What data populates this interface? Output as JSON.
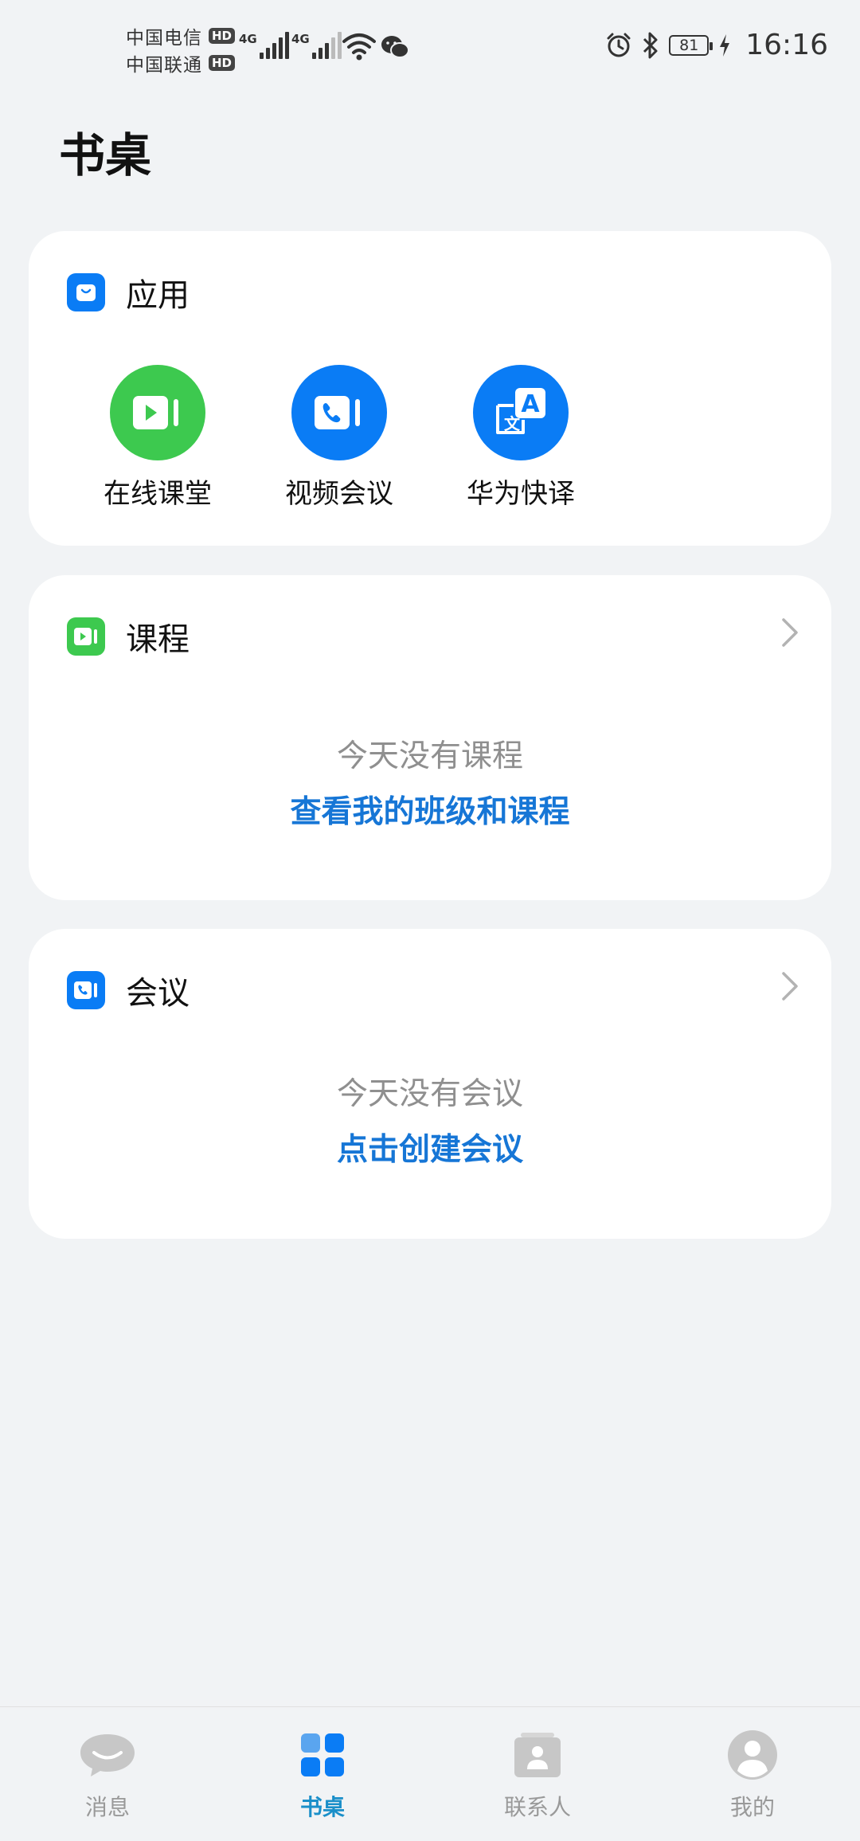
{
  "status_bar": {
    "carriers": [
      {
        "name": "中国电信",
        "badge": "HD"
      },
      {
        "name": "中国联通",
        "badge": "HD"
      }
    ],
    "network_tags": [
      "4G",
      "4G"
    ],
    "battery": "81",
    "time": "16:16"
  },
  "page_title": "书桌",
  "apps_card": {
    "title": "应用",
    "items": [
      {
        "label": "在线课堂",
        "icon": "online-class-icon",
        "color": "#3dc94f"
      },
      {
        "label": "视频会议",
        "icon": "video-call-icon",
        "color": "#0a7cf5"
      },
      {
        "label": "华为快译",
        "icon": "translate-icon",
        "color": "#0a7cf5"
      }
    ]
  },
  "courses_card": {
    "title": "课程",
    "empty_text": "今天没有课程",
    "link_text": "查看我的班级和课程"
  },
  "meetings_card": {
    "title": "会议",
    "empty_text": "今天没有会议",
    "link_text": "点击创建会议"
  },
  "bottom_nav": {
    "items": [
      {
        "label": "消息",
        "icon": "chat-bubble-icon",
        "active": false
      },
      {
        "label": "书桌",
        "icon": "desk-grid-icon",
        "active": true
      },
      {
        "label": "联系人",
        "icon": "contacts-icon",
        "active": false
      },
      {
        "label": "我的",
        "icon": "profile-icon",
        "active": false
      }
    ]
  },
  "colors": {
    "background": "#f1f3f5",
    "card": "#ffffff",
    "link": "#1676d6",
    "nav_active": "#1a8fc9",
    "green": "#3dc94f",
    "blue": "#0a7cf5"
  }
}
